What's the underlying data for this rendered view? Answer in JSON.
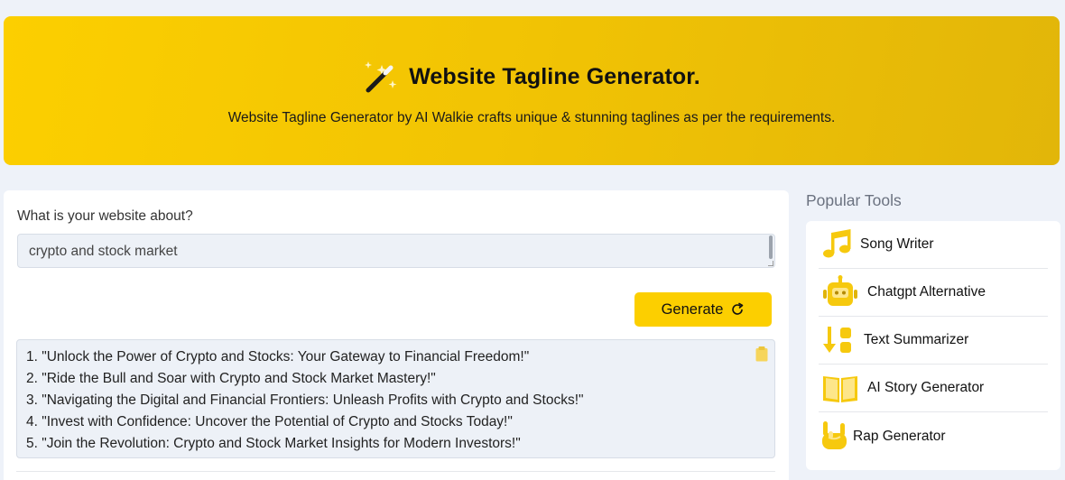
{
  "hero": {
    "title": "Website Tagline Generator.",
    "subtitle": "Website Tagline Generator by AI Walkie crafts unique & stunning taglines as per the requirements.",
    "icon": "magic-wand-icon"
  },
  "form": {
    "label": "What is your website about?",
    "input_value": "crypto and stock market",
    "generate_label": "Generate"
  },
  "results": [
    "1. \"Unlock the Power of Crypto and Stocks: Your Gateway to Financial Freedom!\"",
    "2. \"Ride the Bull and Soar with Crypto and Stock Market Mastery!\"",
    "3. \"Navigating the Digital and Financial Frontiers: Unleash Profits with Crypto and Stocks!\"",
    "4. \"Invest with Confidence: Uncover the Potential of Crypto and Stocks Today!\"",
    "5. \"Join the Revolution: Crypto and Stock Market Insights for Modern Investors!\""
  ],
  "sidebar": {
    "title": "Popular Tools",
    "items": [
      {
        "label": "Song Writer",
        "icon": "music-note-icon"
      },
      {
        "label": "Chatgpt Alternative",
        "icon": "robot-icon"
      },
      {
        "label": "Text Summarizer",
        "icon": "summarize-icon"
      },
      {
        "label": "AI Story Generator",
        "icon": "book-icon"
      },
      {
        "label": "Rap Generator",
        "icon": "rock-hand-icon"
      }
    ]
  },
  "colors": {
    "accent": "#fccf00",
    "page_bg": "#eef2f9",
    "input_bg": "#edf1f7"
  }
}
